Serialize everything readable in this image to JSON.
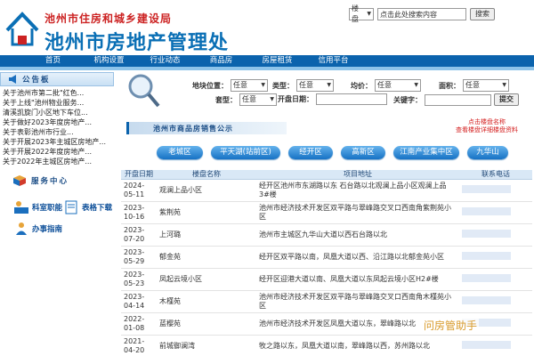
{
  "header": {
    "sub_title": "池州市住房和城乡建设局",
    "main_title": "池州市房地产管理处"
  },
  "search": {
    "scope": "楼盘",
    "placeholder": "点击此处搜索内容",
    "button": "搜索"
  },
  "nav": [
    "首页",
    "机构设置",
    "行业动态",
    "商品房",
    "房屋租赁",
    "信用平台"
  ],
  "notice": {
    "title": "公告板",
    "items": [
      "关于池州市第二批\"红色...",
      "关于上线\"池州物业服务...",
      "清溪凯旋门小区地下车位...",
      "关于做好2023年度房地产...",
      "关于表彰池州市行业...",
      "关于开展2023年主城区房地产...",
      "关于开展2022年度房地产...",
      "关于2022年主城区房地产..."
    ]
  },
  "service": {
    "title": "服务中心",
    "items": [
      "科室职能",
      "表格下载",
      "办事指南"
    ]
  },
  "filter": {
    "location_label": "地块位置：",
    "type_label": "类型：",
    "price_label": "均价：",
    "area_label": "面积：",
    "style_label": "套型：",
    "date_label": "开盘日期：",
    "keyword_label": "关键字：",
    "any": "任意",
    "submit": "提交"
  },
  "section": {
    "title": "池州市商品房销售公示",
    "note_line1": "点击楼盘名称",
    "note_line2": "查看楼盘详细楼盘资料"
  },
  "districts": [
    "老城区",
    "平天湖(站前区)",
    "经开区",
    "高新区",
    "江南产业集中区",
    "九华山"
  ],
  "table": {
    "headers": [
      "开盘日期",
      "楼盘名称",
      "项目地址",
      "联系电话"
    ],
    "rows": [
      {
        "date": "2024-05-11",
        "name": "观澜上品小区",
        "addr": "经开区池州市东湖路以东 石台路以北观澜上品小区观澜上品3#楼"
      },
      {
        "date": "2023-10-16",
        "name": "紫荆苑",
        "addr": "池州市经济技术开发区双平路与翠峰路交叉口西南角紫荆苑小区"
      },
      {
        "date": "2023-07-20",
        "name": "上河璐",
        "addr": "池州市主城区九华山大道以西石台路以北"
      },
      {
        "date": "2023-05-29",
        "name": "郁金苑",
        "addr": "经开区双平路以南，凤凰大道以西、沿江路以北郁金苑小区"
      },
      {
        "date": "2023-05-23",
        "name": "凤起云境小区",
        "addr": "经开区迎港大道以南、凤凰大道以东凤起云境小区H2#楼"
      },
      {
        "date": "2023-04-14",
        "name": "木槿苑",
        "addr": "池州市经济技术开发区双平路与翠峰路交叉口西南角木槿苑小区"
      },
      {
        "date": "2022-01-08",
        "name": "蓝樱苑",
        "addr": "池州市经济技术开发区凤凰大道以东，翠峰路以北"
      },
      {
        "date": "2021-04-20",
        "name": "前城御澜湾",
        "addr": "牧之路以东，凤凰大道以南，翠峰路以西，苏州路以北"
      }
    ]
  },
  "watermark": "问房管助手",
  "colors": {
    "brand_blue": "#0b63ad",
    "title_red": "#cc2222",
    "accent_orange": "#d89a2a"
  }
}
